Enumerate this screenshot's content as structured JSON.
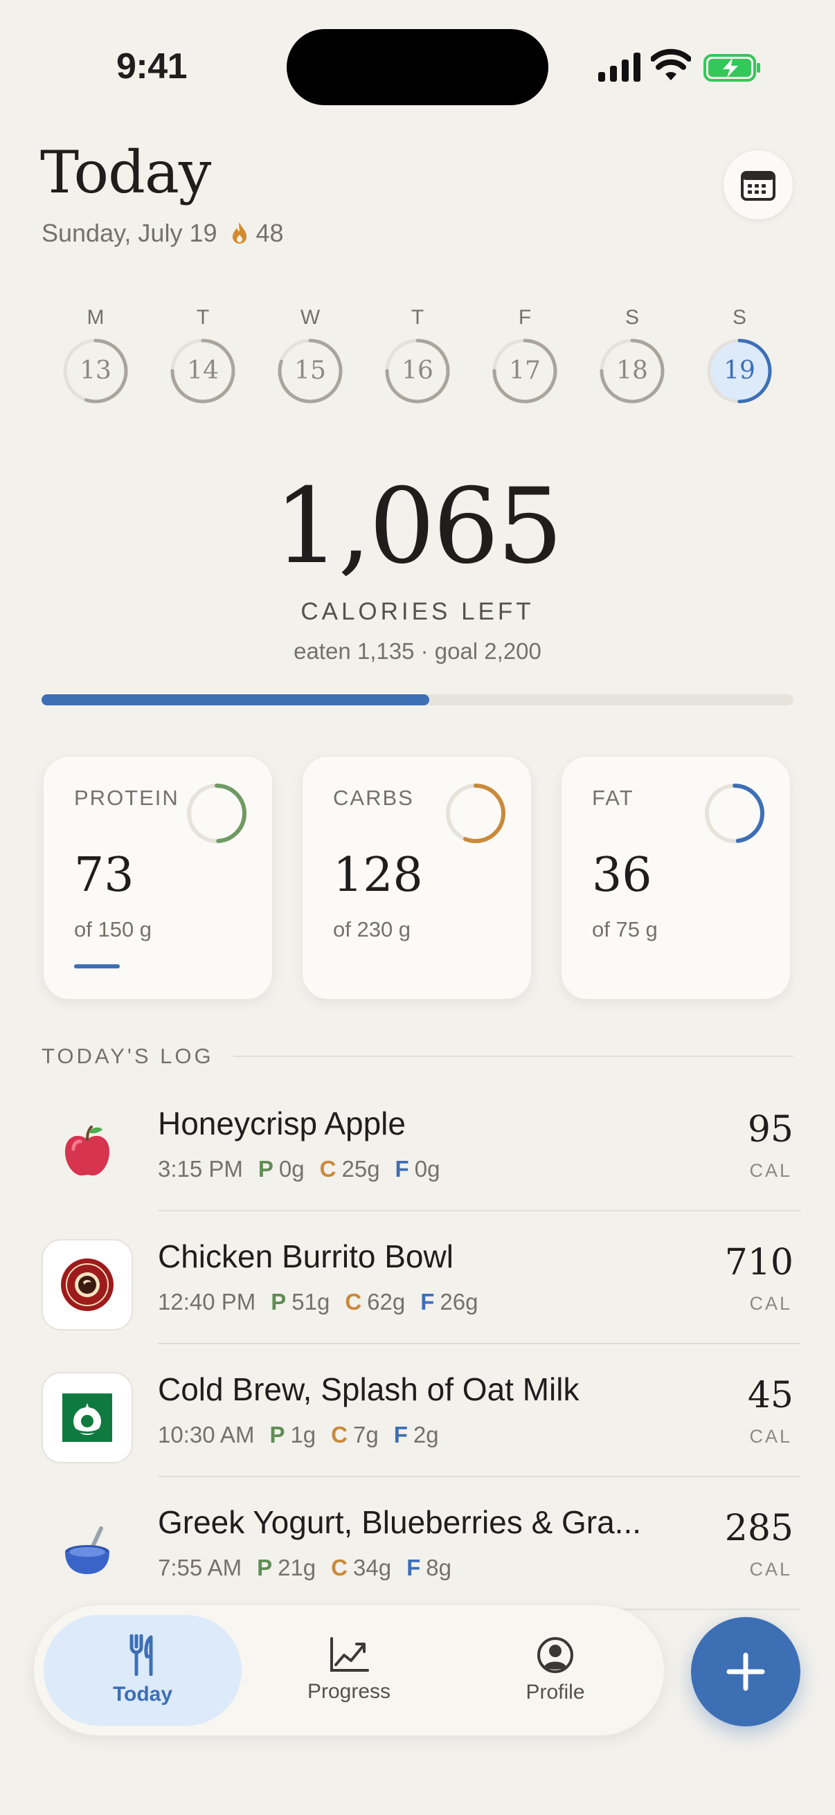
{
  "status_bar": {
    "time": "9:41"
  },
  "header": {
    "title": "Today",
    "date": "Sunday, July 19",
    "streak": "48"
  },
  "week": [
    {
      "letter": "M",
      "date": "13",
      "progress": 0.55,
      "selected": false
    },
    {
      "letter": "T",
      "date": "14",
      "progress": 0.75,
      "selected": false
    },
    {
      "letter": "W",
      "date": "15",
      "progress": 0.8,
      "selected": false
    },
    {
      "letter": "T",
      "date": "16",
      "progress": 0.75,
      "selected": false
    },
    {
      "letter": "F",
      "date": "17",
      "progress": 0.75,
      "selected": false
    },
    {
      "letter": "S",
      "date": "18",
      "progress": 0.75,
      "selected": false
    },
    {
      "letter": "S",
      "date": "19",
      "progress": 0.5,
      "selected": true
    }
  ],
  "calories": {
    "left": "1,065",
    "label": "CALORIES LEFT",
    "summary": "eaten 1,135 · goal 2,200",
    "progress": 0.516
  },
  "macros": [
    {
      "name": "PROTEIN",
      "value": "73",
      "goal": "of 150 g",
      "progress": 0.49,
      "color": "#6f9a63"
    },
    {
      "name": "CARBS",
      "value": "128",
      "goal": "of 230 g",
      "progress": 0.56,
      "color": "#c98a3a"
    },
    {
      "name": "FAT",
      "value": "36",
      "goal": "of 75 g",
      "progress": 0.48,
      "color": "#3d6fb5"
    }
  ],
  "log": {
    "title": "TODAY'S LOG",
    "cal_unit": "CAL",
    "items": [
      {
        "name": "Honeycrisp Apple",
        "time": "3:15 PM",
        "p": "0g",
        "c": "25g",
        "f": "0g",
        "cal": "95",
        "icon": "apple-icon"
      },
      {
        "name": "Chicken Burrito Bowl",
        "time": "12:40 PM",
        "p": "51g",
        "c": "62g",
        "f": "26g",
        "cal": "710",
        "icon": "chipotle-logo"
      },
      {
        "name": "Cold Brew, Splash of Oat Milk",
        "time": "10:30 AM",
        "p": "1g",
        "c": "7g",
        "f": "2g",
        "cal": "45",
        "icon": "starbucks-logo"
      },
      {
        "name": "Greek Yogurt, Blueberries & Gra...",
        "time": "7:55 AM",
        "p": "21g",
        "c": "34g",
        "f": "8g",
        "cal": "285",
        "icon": "yogurt-bowl-icon"
      }
    ]
  },
  "macro_letters": {
    "p": "P",
    "c": "C",
    "f": "F"
  },
  "tabs": [
    {
      "label": "Today",
      "icon": "fork-knife-icon",
      "active": true
    },
    {
      "label": "Progress",
      "icon": "chart-icon",
      "active": false
    },
    {
      "label": "Profile",
      "icon": "profile-icon",
      "active": false
    }
  ],
  "colors": {
    "accent": "#3d6fb5",
    "protein": "#6f9a63",
    "carbs": "#c98a3a",
    "fat": "#3d6fb5",
    "background": "#f3f1ec"
  }
}
